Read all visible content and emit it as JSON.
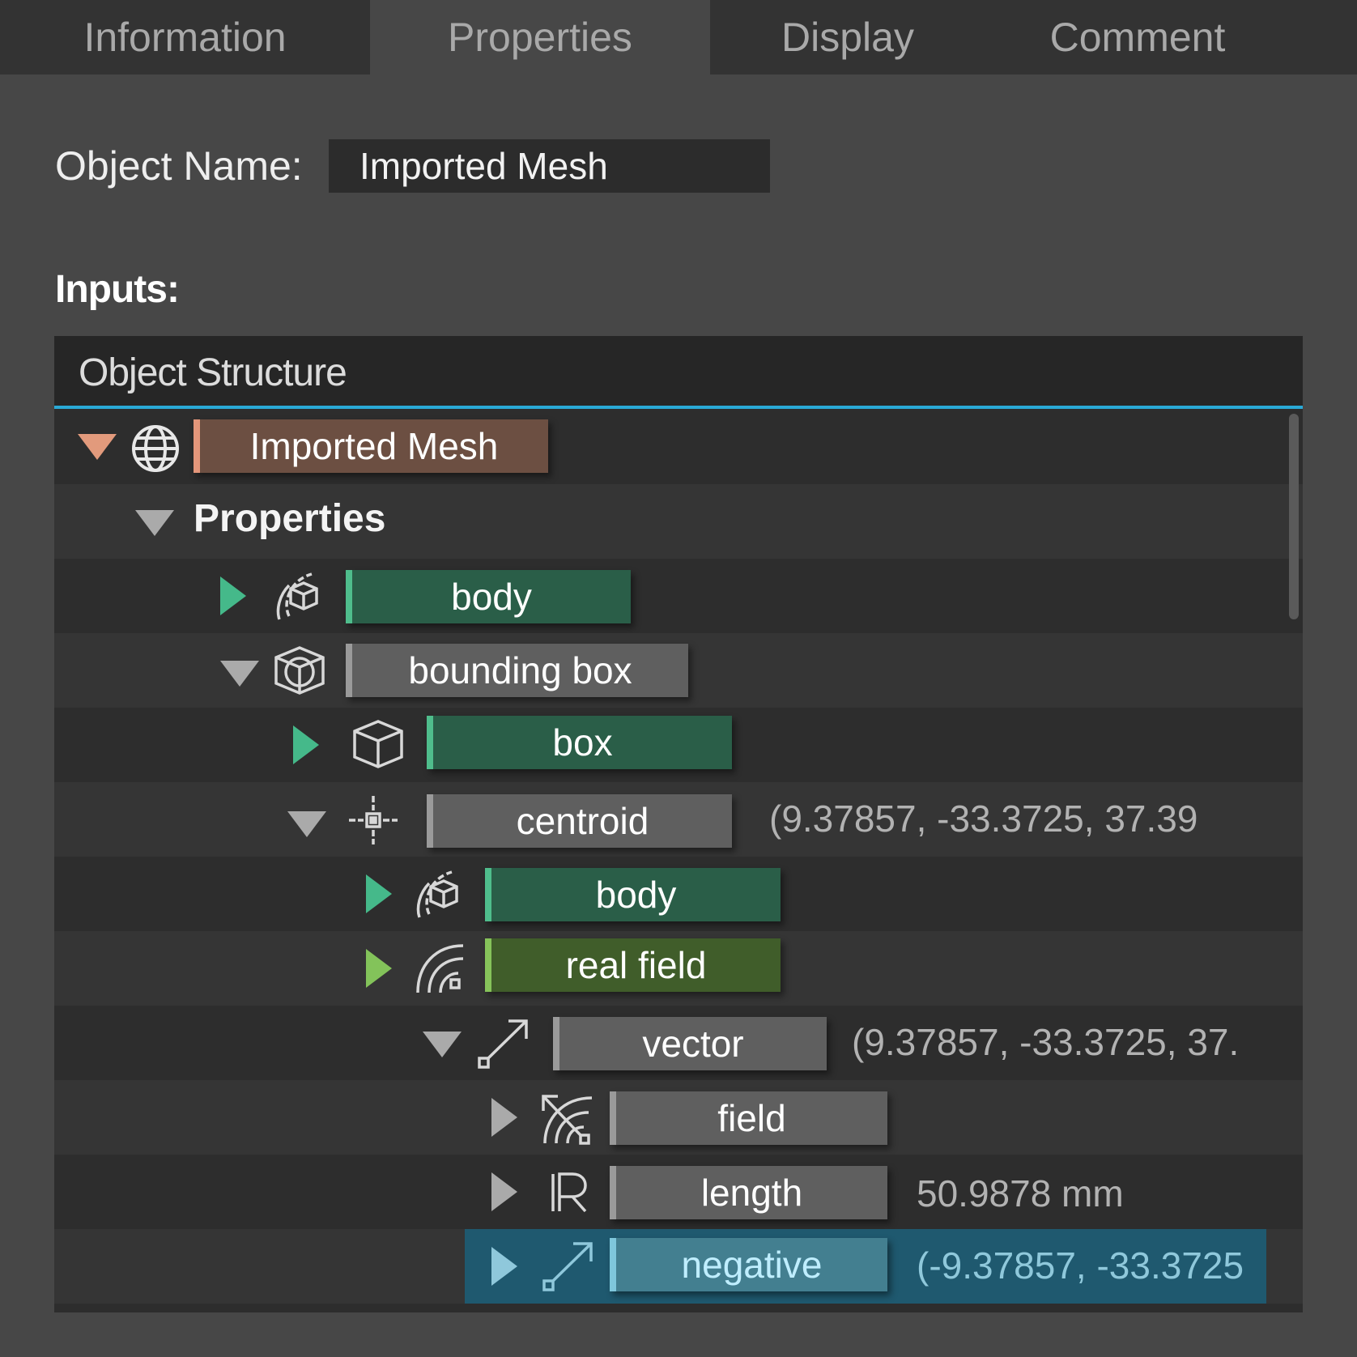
{
  "tabs": [
    {
      "label": "Information"
    },
    {
      "label": "Properties"
    },
    {
      "label": "Display"
    },
    {
      "label": "Comment"
    }
  ],
  "object_name": {
    "label": "Object Name:",
    "value": "Imported Mesh"
  },
  "inputs_label": "Inputs:",
  "panel": {
    "title": "Object Structure"
  },
  "tree": {
    "root": {
      "label": "Imported Mesh",
      "icon": "globe-icon"
    },
    "properties": {
      "label": "Properties"
    },
    "body1": {
      "label": "body",
      "icon": "body-icon"
    },
    "bounding_box": {
      "label": "bounding box",
      "icon": "bounding-box-icon"
    },
    "box": {
      "label": "box",
      "icon": "box-icon"
    },
    "centroid": {
      "label": "centroid",
      "icon": "centroid-icon",
      "value": "(9.37857, -33.3725, 37.39"
    },
    "body2": {
      "label": "body",
      "icon": "body-icon"
    },
    "real_field": {
      "label": "real field",
      "icon": "field-icon"
    },
    "vector": {
      "label": "vector",
      "icon": "vector-icon",
      "value": "(9.37857, -33.3725, 37."
    },
    "field": {
      "label": "field",
      "icon": "vector-field-icon"
    },
    "length": {
      "label": "length",
      "icon": "real-number-icon",
      "value": "50.9878 mm"
    },
    "negative": {
      "label": "negative",
      "icon": "vector-icon",
      "value": "(-9.37857, -33.3725"
    }
  },
  "colors": {
    "accent": "#2aa9d6",
    "mesh_tag": "#6c4f42",
    "green_tag": "#2a5e48",
    "olive_tag": "#405d2a",
    "grey_tag": "#5f5f5f",
    "selected_row": "#1f596f"
  }
}
